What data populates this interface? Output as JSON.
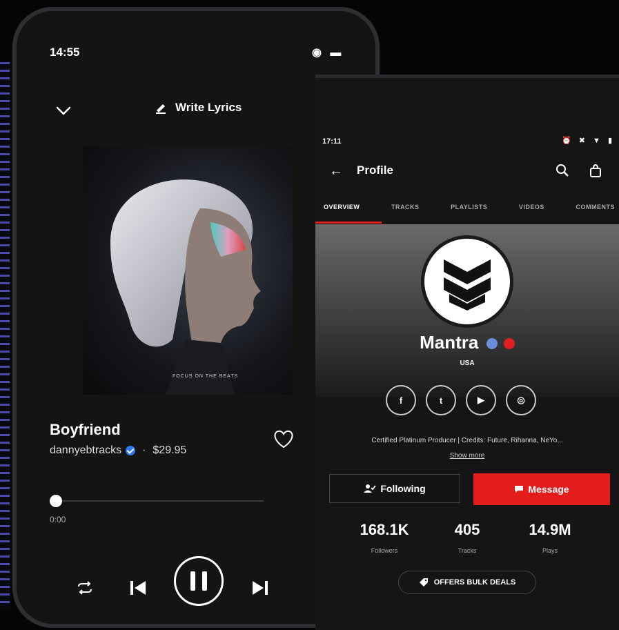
{
  "player": {
    "time": "14:55",
    "status_icons": "◉ ▬",
    "write_lyrics": "Write Lyrics",
    "song_title": "Boyfriend",
    "artist": "dannyebtracks",
    "separator": "·",
    "price": "$29.95",
    "cover_caption": "FOCUS ON THE BEATS",
    "elapsed": "0:00"
  },
  "profile": {
    "time": "17:11",
    "status_icons": "⏰ ✖ ▼ ▮",
    "back_glyph": "←",
    "title": "Profile",
    "tabs": [
      "OVERVIEW",
      "TRACKS",
      "PLAYLISTS",
      "VIDEOS",
      "COMMENTS"
    ],
    "name": "Mantra",
    "country": "USA",
    "socials": [
      "f",
      "t",
      "▶",
      "◎"
    ],
    "bio": "Certified Platinum Producer | Credits: Future, Rihanna, NeYo...",
    "show_more": "Show more",
    "following_label": "Following",
    "message_label": "Message",
    "stats": [
      {
        "value": "168.1K",
        "label": "Followers"
      },
      {
        "value": "405",
        "label": "Tracks"
      },
      {
        "value": "14.9M",
        "label": "Plays"
      }
    ],
    "bulk_label": "OFFERS BULK DEALS"
  },
  "colors": {
    "accent_red": "#e31c1c",
    "verified_blue": "#2d7bf0",
    "background": "#141414"
  }
}
